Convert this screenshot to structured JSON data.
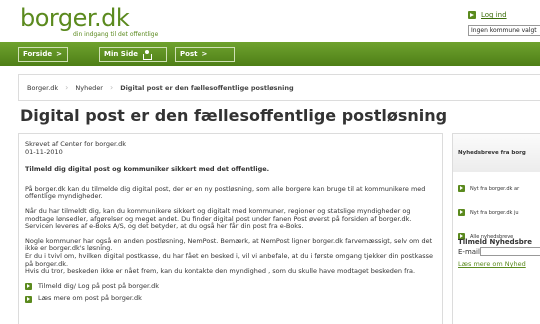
{
  "header": {
    "logo_text": "borger.dk",
    "logo_tagline": "din indgang til det offentlige",
    "login_label": "Log ind",
    "municipality_select": "Ingen kommune valgt"
  },
  "nav": {
    "forside": "Forside",
    "min_side": "Min Side",
    "post": "Post",
    "chevron": ">"
  },
  "breadcrumb": {
    "items": [
      "Borger.dk",
      "Nyheder",
      "Digital post er den fællesoffentlige postløsning"
    ],
    "separator": "›"
  },
  "page": {
    "title": "Digital post er den fællesoffentlige postløsning"
  },
  "article": {
    "byline_author": "Skrevet af Center for borger.dk",
    "byline_date": "01-11-2010",
    "lead": "Tilmeld dig digital post og kommuniker sikkert med det offentlige.",
    "paragraphs": [
      "På borger.dk kan du tilmelde dig digital post, der er en ny postløsning, som alle borgere kan bruge til at kommunikere med offentlige myndigheder.",
      "Når du har tilmeldt dig, kan du kommunikere sikkert og digitalt med kommuner, regioner og statslige myndigheder og modtage lønsedler, afgørelser og meget andet. Du finder digital post under fanen Post øverst på forsiden af borger.dk. Servicen leveres af e-Boks A/S, og det betyder, at du også her får din post fra e-Boks.",
      "Nogle kommuner har også en anden postløsning, NemPost. Bemærk, at NemPost ligner borger.dk farvemæssigt, selv om det ikke er borger.dk's løsning.\nEr du i tvivl om, hvilken digital postkasse, du har fået en besked i, vil vi anbefale, at du i første omgang tjekker din postkasse på borger.dk.\nHvis du tror, beskeden ikke er nået frem, kan du kontakte den myndighed , som du skulle have modtaget beskeden fra."
    ],
    "links": [
      "Tilmeld dig/ Log på post på borger.dk",
      "Læs mere om post på borger.dk"
    ]
  },
  "sidebar": {
    "title": "Nyhedsbreve fra borg",
    "links": [
      "Nyt fra borger.dk ar",
      "Nyt fra borger.dk ju",
      "Alle nyhedsbreve"
    ],
    "subscribe_title": "Tilmeld Nyhedsbre",
    "email_label": "E-mail:",
    "more_link": "Læs mere om Nyhed"
  },
  "colors": {
    "brand_green": "#5b8a1e",
    "nav_green": "#4e7f17"
  }
}
